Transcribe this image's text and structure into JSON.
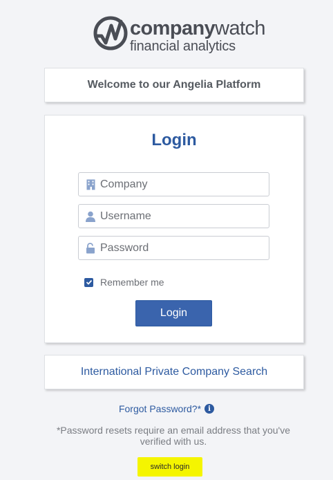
{
  "brand": {
    "name_bold": "company",
    "name_light": "watch",
    "tagline": "financial analytics",
    "colors": {
      "logo_gray": "#4a4d55",
      "primary_blue": "#2d5aa0",
      "button_blue": "#3a64ad",
      "highlight_yellow": "#f5f500"
    }
  },
  "welcome": {
    "text": "Welcome to our Angelia Platform"
  },
  "login": {
    "title": "Login",
    "fields": {
      "company": {
        "placeholder": "Company",
        "icon": "building-icon",
        "value": ""
      },
      "username": {
        "placeholder": "Username",
        "icon": "user-icon",
        "value": ""
      },
      "password": {
        "placeholder": "Password",
        "icon": "unlock-icon",
        "value": ""
      }
    },
    "remember_me": {
      "label": "Remember me",
      "checked": true
    },
    "submit_label": "Login"
  },
  "international_search": {
    "label": "International Private Company Search"
  },
  "forgot_password": {
    "label": "Forgot Password?*",
    "icon": "info-icon"
  },
  "reset_note": "*Password resets require an email address that you've verified with us.",
  "switch_login": {
    "label": "switch login"
  }
}
